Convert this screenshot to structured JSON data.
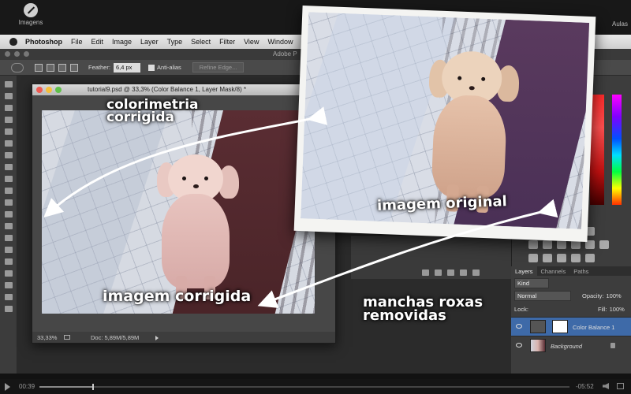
{
  "video": {
    "images_label": "Imagens",
    "aulas_label": "Aulas",
    "current_time": "00:39",
    "duration": "-05:52",
    "progress": 0.1
  },
  "menubar": {
    "app": "Photoshop",
    "items": [
      "File",
      "Edit",
      "Image",
      "Layer",
      "Type",
      "Select",
      "Filter",
      "View",
      "Window"
    ]
  },
  "ps": {
    "window_title": "Adobe P"
  },
  "options": {
    "feather_label": "Feather:",
    "feather_value": "6,4 px",
    "antialias_label": "Anti-alias",
    "refine_edge": "Refine Edge..."
  },
  "document": {
    "title": "tutorial9.psd @ 33,3% (Color Balance 1, Layer Mask/8) *",
    "zoom": "33,33%",
    "doc_size": "Doc: 5,89M/5,89M"
  },
  "layers_panel": {
    "tabs": [
      "Layers",
      "Channels",
      "Paths"
    ],
    "filter_kind": "Kind",
    "blend_mode": "Normal",
    "opacity_label": "Opacity:",
    "opacity_value": "100%",
    "lock_label": "Lock:",
    "fill_label": "Fill:",
    "fill_value": "100%",
    "layers": [
      {
        "name": "Color Balance 1",
        "selected": true
      },
      {
        "name": "Background",
        "selected": false
      }
    ]
  },
  "annotations": {
    "colorimetria": "colorimetria corrigida",
    "imagem_original": "imagem original",
    "imagem_corrigida": "imagem corrigida",
    "manchas": "manchas roxas removidas"
  },
  "colors": {
    "accent_layer": "#3e6aa8",
    "close": "#ee5a52",
    "minimize": "#f5be3b",
    "zoom": "#5fc04a"
  }
}
